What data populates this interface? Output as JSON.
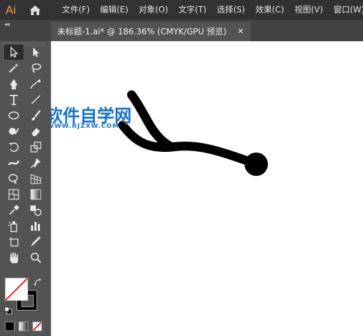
{
  "app": {
    "logo": "Ai"
  },
  "menu": {
    "items": [
      "文件(F)",
      "编辑(E)",
      "对象(O)",
      "文字(T)",
      "选择(S)",
      "效果(C)",
      "视图(V)",
      "窗口(W)"
    ]
  },
  "tabs": {
    "collapse": "◂◂",
    "document": {
      "title": "未标题-1.ai* @ 186.36% (CMYK/GPU 预览)",
      "close": "✕"
    }
  },
  "watermark": {
    "text": "软件自学网",
    "url": "WWW.RJZXW.COM"
  },
  "colors": {
    "menubar_bg": "#323232",
    "panel_bg": "#535353",
    "canvas_bg": "#ffffff",
    "logo": "#f59b42",
    "watermark": "#1672c8",
    "artwork_stroke": "#000000",
    "none_slash": "#e02020"
  },
  "tools": [
    "selection-tool",
    "direct-selection-tool",
    "magic-wand-tool",
    "lasso-tool",
    "pen-tool",
    "curvature-tool",
    "type-tool",
    "line-segment-tool",
    "ellipse-tool",
    "paintbrush-tool",
    "shaper-tool",
    "eraser-tool",
    "rotate-tool",
    "scale-tool",
    "width-tool",
    "puppet-warp-tool",
    "shape-builder-tool",
    "perspective-grid-tool",
    "mesh-tool",
    "gradient-tool",
    "eyedropper-tool",
    "blend-tool",
    "symbol-sprayer-tool",
    "column-graph-tool",
    "artboard-tool",
    "slice-tool",
    "hand-tool",
    "zoom-tool"
  ]
}
